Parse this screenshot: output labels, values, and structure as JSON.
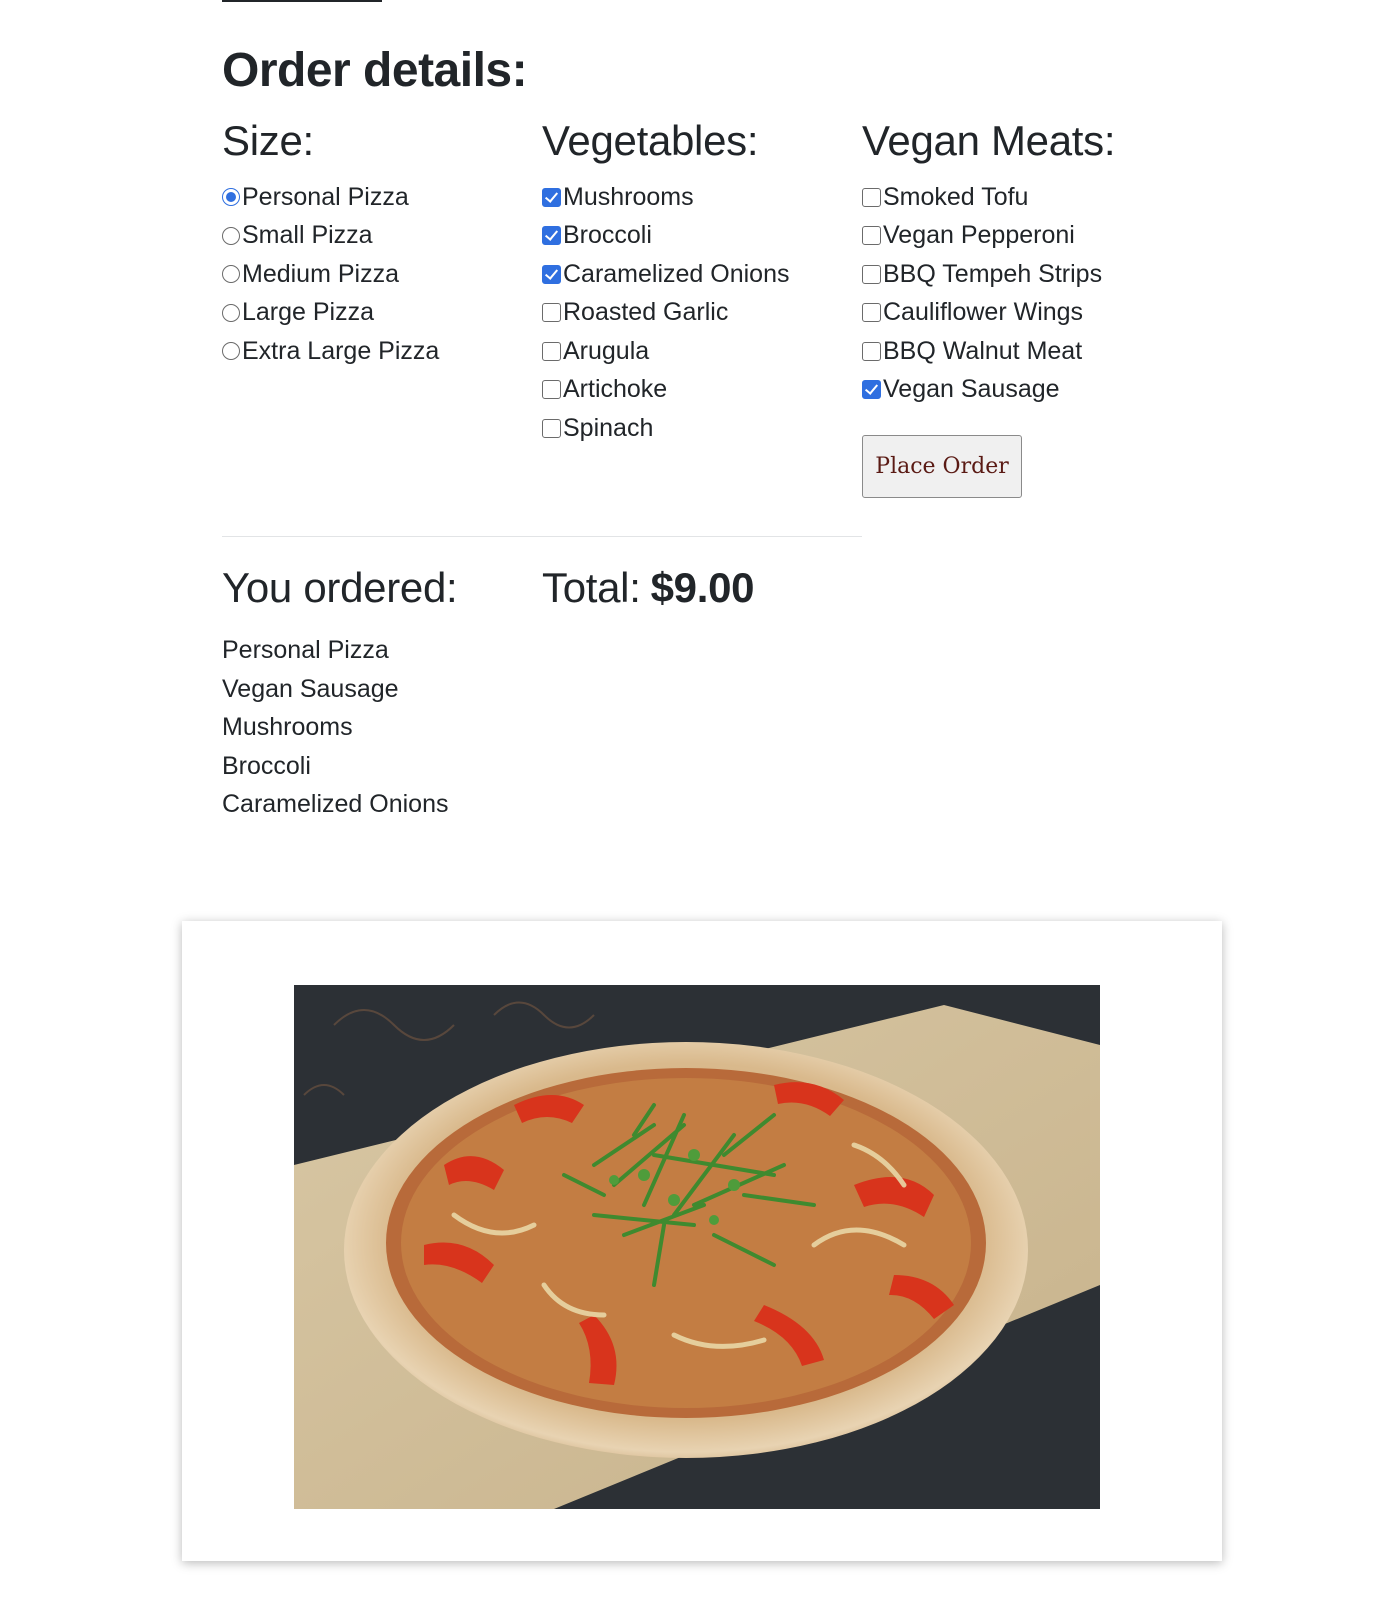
{
  "order": {
    "title": "Order details:"
  },
  "size": {
    "title": "Size:",
    "options": [
      {
        "label": "Personal Pizza",
        "checked": true
      },
      {
        "label": "Small Pizza",
        "checked": false
      },
      {
        "label": "Medium Pizza",
        "checked": false
      },
      {
        "label": "Large Pizza",
        "checked": false
      },
      {
        "label": "Extra Large Pizza",
        "checked": false
      }
    ]
  },
  "vegetables": {
    "title": "Vegetables:",
    "options": [
      {
        "label": "Mushrooms",
        "checked": true
      },
      {
        "label": "Broccoli",
        "checked": true
      },
      {
        "label": "Caramelized Onions",
        "checked": true
      },
      {
        "label": "Roasted Garlic",
        "checked": false
      },
      {
        "label": "Arugula",
        "checked": false
      },
      {
        "label": "Artichoke",
        "checked": false
      },
      {
        "label": "Spinach",
        "checked": false
      }
    ]
  },
  "meats": {
    "title": "Vegan Meats:",
    "options": [
      {
        "label": "Smoked Tofu",
        "checked": false
      },
      {
        "label": "Vegan Pepperoni",
        "checked": false
      },
      {
        "label": "BBQ Tempeh Strips",
        "checked": false
      },
      {
        "label": "Cauliflower Wings",
        "checked": false
      },
      {
        "label": "BBQ Walnut Meat",
        "checked": false
      },
      {
        "label": "Vegan Sausage",
        "checked": true
      }
    ]
  },
  "actions": {
    "place_order_label": "Place Order"
  },
  "summary": {
    "ordered_title": "You ordered:",
    "total_label": "Total:",
    "total_amount": "$9.00",
    "items": [
      "Personal Pizza",
      "Vegan Sausage",
      "Mushrooms",
      "Broccoli",
      "Caramelized Onions"
    ]
  },
  "colors": {
    "accent": "#2f6fe0",
    "text": "#212529",
    "button_text": "#5a1a14"
  }
}
